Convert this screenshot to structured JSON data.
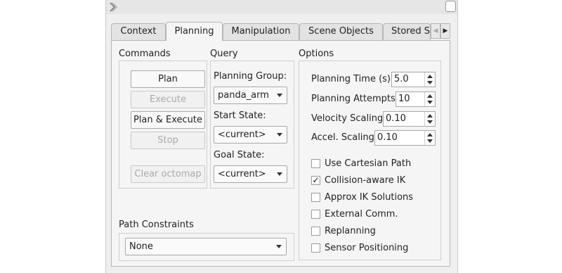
{
  "tabs": [
    {
      "label": "Context",
      "active": false
    },
    {
      "label": "Planning",
      "active": true
    },
    {
      "label": "Manipulation",
      "active": false
    },
    {
      "label": "Scene Objects",
      "active": false
    },
    {
      "label": "Stored S",
      "active": false
    }
  ],
  "tab_scroll": {
    "left": "◀",
    "right": "▶"
  },
  "commands": {
    "title": "Commands",
    "plan": "Plan",
    "execute": "Execute",
    "plan_execute": "Plan & Execute",
    "stop": "Stop",
    "clear_octomap": "Clear octomap"
  },
  "query": {
    "title": "Query",
    "planning_group_label": "Planning Group:",
    "planning_group_value": "panda_arm",
    "start_state_label": "Start State:",
    "start_state_value": "<current>",
    "goal_state_label": "Goal State:",
    "goal_state_value": "<current>"
  },
  "options": {
    "title": "Options",
    "planning_time_label": "Planning Time (s):",
    "planning_time_value": "5.0",
    "planning_attempts_label": "Planning Attempts:",
    "planning_attempts_value": "10",
    "velocity_scaling_label": "Velocity Scaling:",
    "velocity_scaling_value": "0.10",
    "accel_scaling_label": "Accel. Scaling:",
    "accel_scaling_value": "0.10",
    "checkboxes": [
      {
        "label": "Use Cartesian Path",
        "checked": false
      },
      {
        "label": "Collision-aware IK",
        "checked": true
      },
      {
        "label": "Approx IK Solutions",
        "checked": false
      },
      {
        "label": "External Comm.",
        "checked": false
      },
      {
        "label": "Replanning",
        "checked": false
      },
      {
        "label": "Sensor Positioning",
        "checked": false
      }
    ]
  },
  "path_constraints": {
    "title": "Path Constraints",
    "value": "None"
  },
  "check_mark": "✓"
}
